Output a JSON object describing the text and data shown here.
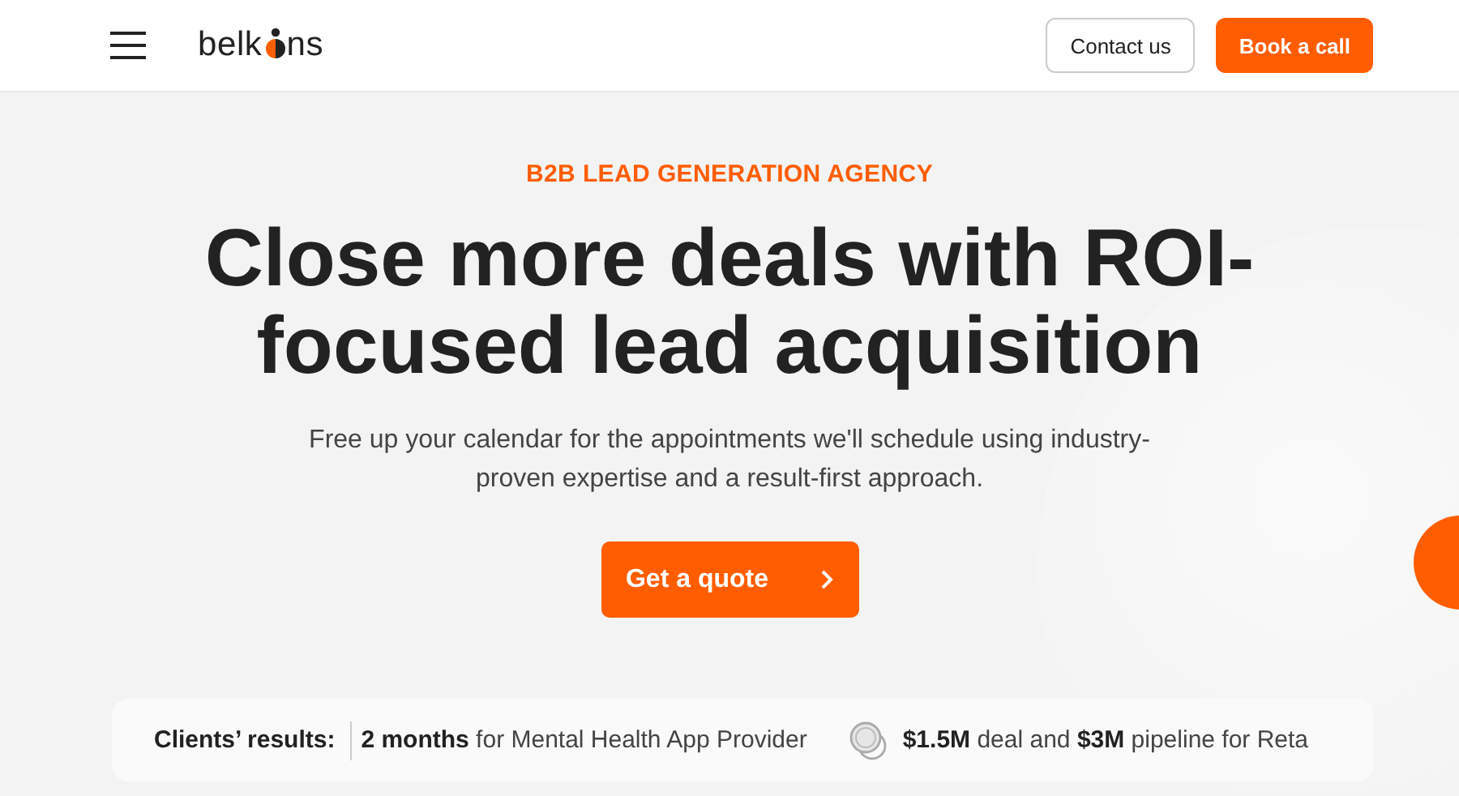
{
  "header": {
    "logo": {
      "before": "belk",
      "after": "ns"
    },
    "buttons": [
      {
        "label": "Contact us",
        "kind": "outline"
      },
      {
        "label": "Book a call",
        "kind": "primary"
      }
    ]
  },
  "hero": {
    "eyebrow": "B2B LEAD GENERATION AGENCY",
    "title": "Close more deals with ROI-focused lead acquisition",
    "subtitle": "Free up your calendar for the appointments we'll schedule using industry-proven expertise and a result-first approach.",
    "cta": "Get a quote"
  },
  "results": {
    "label": "Clients’ results:",
    "items": [
      {
        "text": "**2 months** for Mental Health App Provider",
        "kind": "plain"
      },
      {
        "text": "**$1.5M** deal and **$3M** pipeline for Reta",
        "kind": "coin"
      }
    ]
  }
}
